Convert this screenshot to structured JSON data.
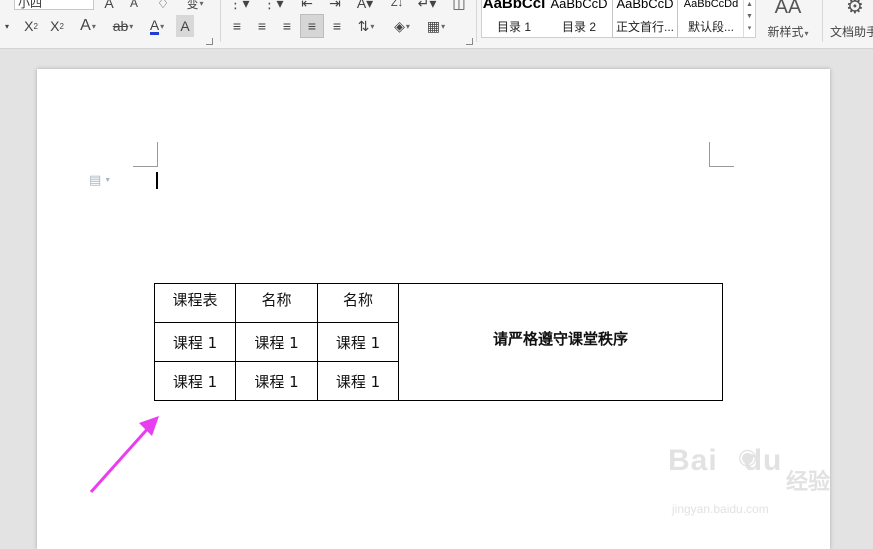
{
  "ribbon": {
    "font_size_value": "小四",
    "font_group": {
      "row1_icons": [
        "grow-font-icon",
        "shrink-font-icon",
        "clear-format-icon",
        "phonetic-icon"
      ],
      "superscript_icon": "superscript-icon",
      "subscript_icon": "subscript-icon",
      "text_effect_icon": "text-effect-icon",
      "highlight_icon": "highlight-icon",
      "font_color_icon": "font-color-icon",
      "char_shading_icon": "char-shading-icon"
    },
    "paragraph_group": {
      "align_left_icon": "align-left-icon",
      "align_center_icon": "align-center-icon",
      "align_right_icon": "align-right-icon",
      "justify_icon": "justify-icon",
      "distributed_icon": "distributed-icon",
      "line_spacing_icon": "line-spacing-icon",
      "shading_icon": "paragraph-shading-icon",
      "border_icon": "border-icon"
    },
    "styles": [
      {
        "preview": "AaBbCcI",
        "name": "目录 1"
      },
      {
        "preview": "AaBbCcD",
        "name": "目录 2"
      },
      {
        "preview": "AaBbCcD",
        "name": "正文首行..."
      },
      {
        "preview": "AaBbCcDd",
        "name": "默认段..."
      }
    ],
    "new_style_label": "新样式",
    "doc_assistant_label": "文档助手"
  },
  "document": {
    "table": {
      "rows": [
        [
          "课程表",
          "名称",
          "名称"
        ],
        [
          "课程 1",
          "课程 1",
          "课程 1"
        ],
        [
          "课程 1",
          "课程 1",
          "课程 1"
        ]
      ],
      "merged_cell": "请严格遵守课堂秩序"
    },
    "annotation_arrow_color": "#e83ef0"
  },
  "watermark": {
    "brand": "Bai",
    "brand_suffix": "du",
    "cn": "经验",
    "url": "jingyan.baidu.com"
  },
  "colors": {
    "font_color_underline": "#1f3fd4",
    "arrow": "#e83ef0"
  }
}
